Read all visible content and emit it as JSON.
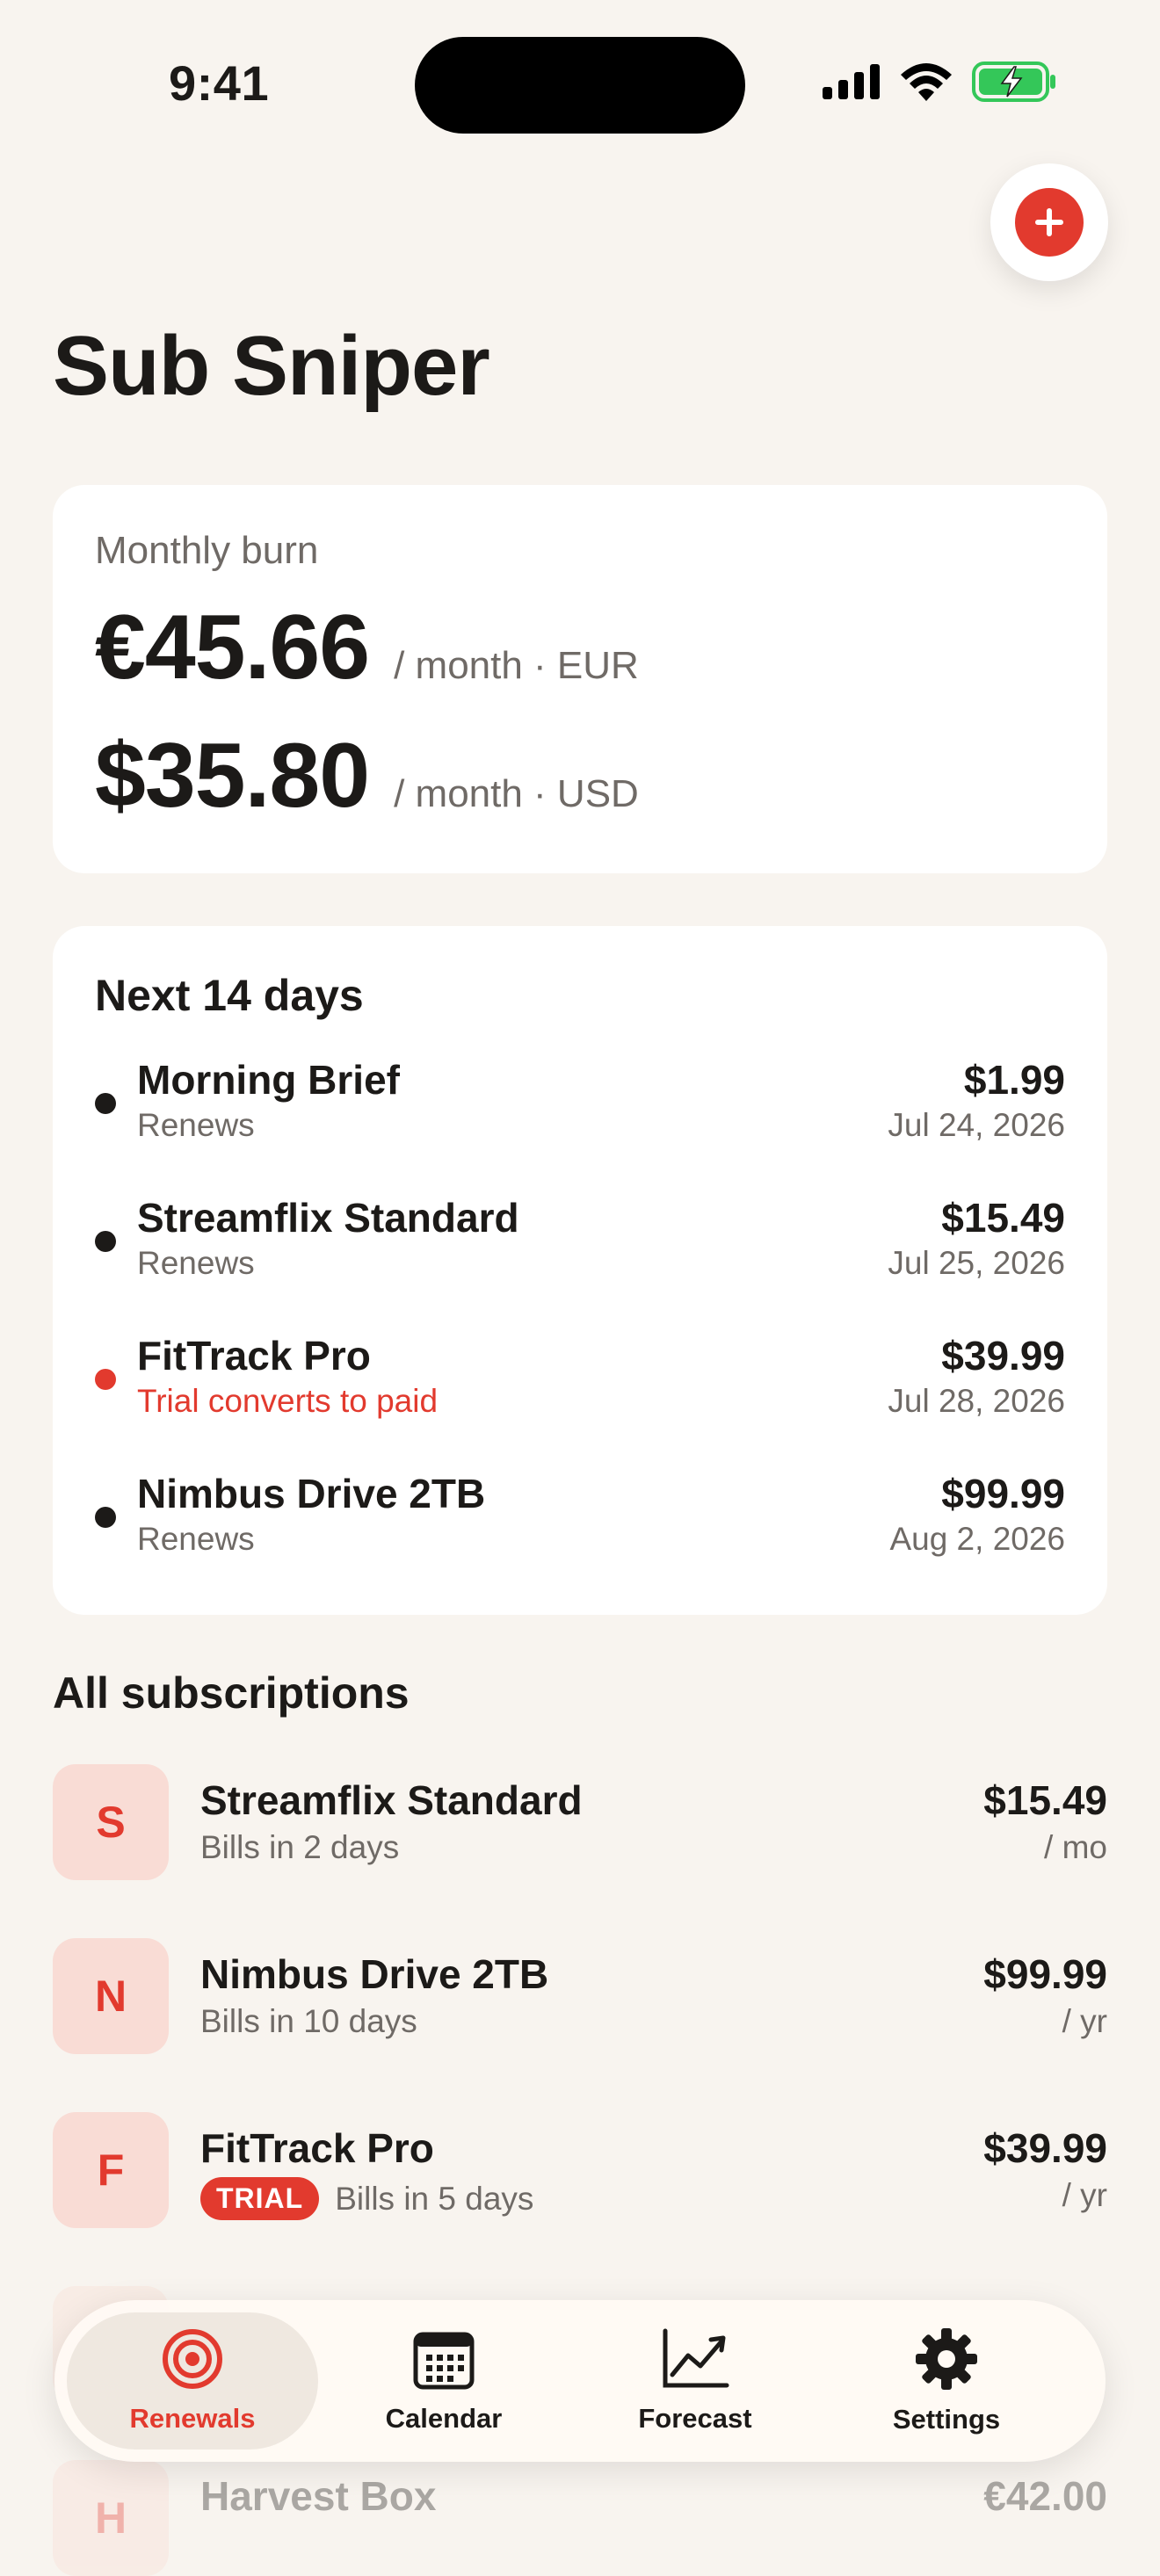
{
  "status_bar": {
    "time": "9:41"
  },
  "app": {
    "title": "Sub Sniper"
  },
  "burn": {
    "label": "Monthly burn",
    "rows": [
      {
        "amount": "€45.66",
        "unit": "/ month · EUR"
      },
      {
        "amount": "$35.80",
        "unit": "/ month · USD"
      }
    ]
  },
  "next": {
    "title": "Next 14 days",
    "items": [
      {
        "name": "Morning Brief",
        "status": "Renews",
        "price": "$1.99",
        "date": "Jul 24, 2026"
      },
      {
        "name": "Streamflix Standard",
        "status": "Renews",
        "price": "$15.49",
        "date": "Jul 25, 2026"
      },
      {
        "name": "FitTrack Pro",
        "status": "Trial converts to paid",
        "price": "$39.99",
        "date": "Jul 28, 2026"
      },
      {
        "name": "Nimbus Drive 2TB",
        "status": "Renews",
        "price": "$99.99",
        "date": "Aug 2, 2026"
      }
    ]
  },
  "subs": {
    "title": "All subscriptions",
    "items": [
      {
        "initial": "S",
        "name": "Streamflix Standard",
        "meta": "Bills in 2 days",
        "price": "$15.49",
        "period": "/ mo"
      },
      {
        "initial": "N",
        "name": "Nimbus Drive 2TB",
        "meta": "Bills in 10 days",
        "price": "$99.99",
        "period": "/ yr"
      },
      {
        "initial": "F",
        "name": "FitTrack Pro",
        "badge": "TRIAL",
        "meta": "Bills in 5 days",
        "price": "$39.99",
        "period": "/ yr"
      },
      {
        "initial": "H",
        "name": "Harvest Box",
        "price": "€42.00"
      }
    ]
  },
  "tabs": [
    {
      "label": "Renewals",
      "icon": "target-icon",
      "active": true
    },
    {
      "label": "Calendar",
      "icon": "calendar-icon"
    },
    {
      "label": "Forecast",
      "icon": "chart-line-icon"
    },
    {
      "label": "Settings",
      "icon": "gear-icon"
    }
  ],
  "colors": {
    "accent": "#E23A2E",
    "background": "#F8F4EF",
    "card": "#FFFFFF"
  }
}
